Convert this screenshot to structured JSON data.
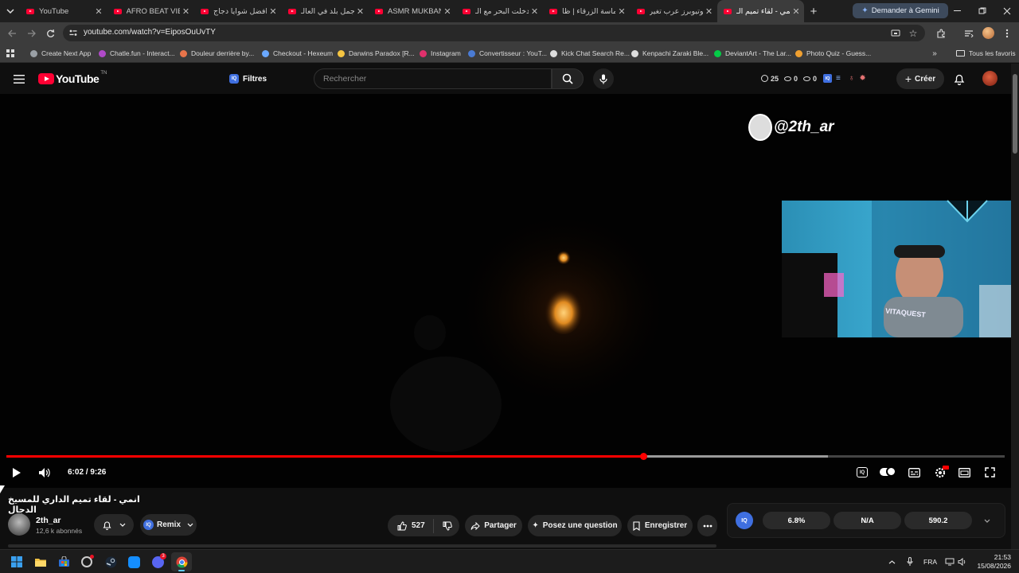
{
  "tabs": [
    {
      "title": "YouTube",
      "active": false
    },
    {
      "title": "AFRO BEAT VIBE",
      "active": false
    },
    {
      "title": "افضل شوايا دجاج",
      "active": false
    },
    {
      "title": "أجمل بلد في العالـ",
      "active": false
    },
    {
      "title": "ASMR MUKBANG",
      "active": false
    },
    {
      "title": "دخلت البحر مع الـ",
      "active": false
    },
    {
      "title": "الماسة الزرقاء | ظا",
      "active": false
    },
    {
      "title": "يوتيوبرز عرب تغير",
      "active": false
    },
    {
      "title": "انمي - لقاء تميم الـ",
      "active": true
    }
  ],
  "gemini_button": "Demander à Gemini",
  "address": {
    "url": "youtube.com/watch?v=EiposOuUvTY"
  },
  "bookmarks": [
    {
      "label": "Create Next App",
      "color": "#9aa0a6"
    },
    {
      "label": "Chatle.fun - Interact...",
      "color": "#b04ac8"
    },
    {
      "label": "Douleur derrière by...",
      "color": "#e8744a"
    },
    {
      "label": "Checkout - Hexeum",
      "color": "#6aa8ff"
    },
    {
      "label": "Darwins Paradox [R...",
      "color": "#f5c542"
    },
    {
      "label": "Instagram",
      "color": "#e1306c"
    },
    {
      "label": "Convertisseur : YouT...",
      "color": "#4a7bd4"
    },
    {
      "label": "Kick Chat Search Re...",
      "color": "#dddddd"
    },
    {
      "label": "Kenpachi Zaraki Ble...",
      "color": "#dddddd"
    },
    {
      "label": "DeviantArt - The Lar...",
      "color": "#05cc47"
    },
    {
      "label": "Photo Quiz - Guess...",
      "color": "#f0a030"
    }
  ],
  "bookmarks_all": "Tous les favoris",
  "youtube": {
    "logo_text": "YouTube",
    "logo_sup": "TN",
    "filters_label": "Filtres",
    "search_placeholder": "Rechercher",
    "stats": {
      "time": "25",
      "views": "0",
      "eye": "0"
    },
    "create_label": "Créer"
  },
  "video": {
    "watermark": "@2th_ar",
    "time_current": "6:02",
    "time_total": "9:26",
    "time_display": "6:02 / 9:26",
    "progress_fraction": 0.638,
    "buffered_fraction": 0.823,
    "shirt_text": "VITAQUEST"
  },
  "details": {
    "title": "انمي - لقاء تميم الداري للمسيخ الدجال",
    "channel_name": "2th_ar",
    "subscribers": "12,6 k abonnés",
    "remix_label": "Remix",
    "likes": "527",
    "share_label": "Partager",
    "ask_label": "Posez une question",
    "save_label": "Enregistrer"
  },
  "iq_panel": {
    "badge": "IQ",
    "v1": "6.8%",
    "v2": "N/A",
    "v3": "590.2"
  },
  "taskbar": {
    "lang": "FRA",
    "time": "21:53",
    "date": "15/08/2026",
    "discord_badge": "3"
  },
  "colors": {
    "accent_red": "#ff0033",
    "progress_red": "#f00",
    "bg_dark": "#0f0f0f"
  }
}
